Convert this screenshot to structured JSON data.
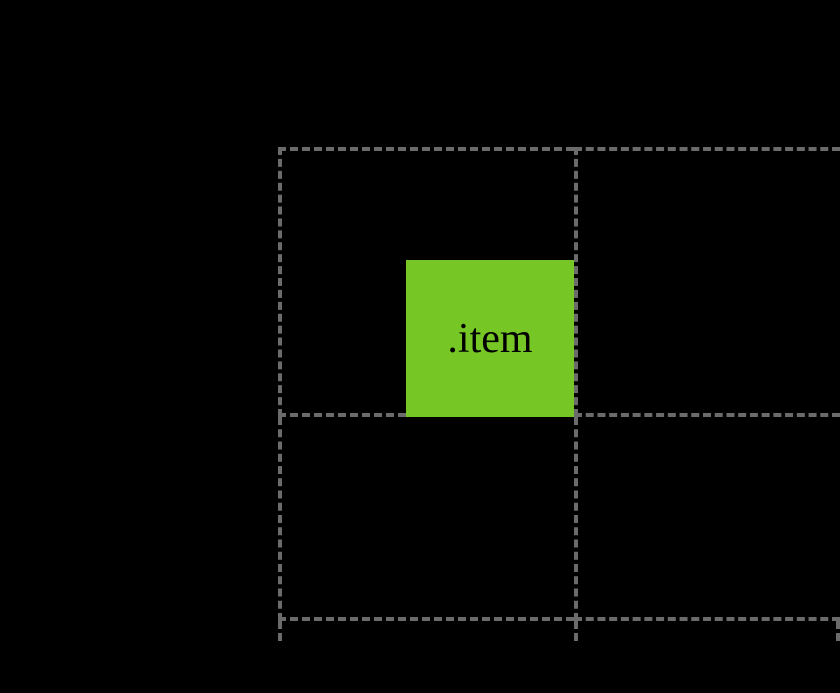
{
  "diagram": {
    "item_label": ".item",
    "colors": {
      "background": "#000000",
      "grid_lines": "#6b6b6b",
      "item_fill": "#76c626",
      "item_text": "#000000"
    }
  }
}
